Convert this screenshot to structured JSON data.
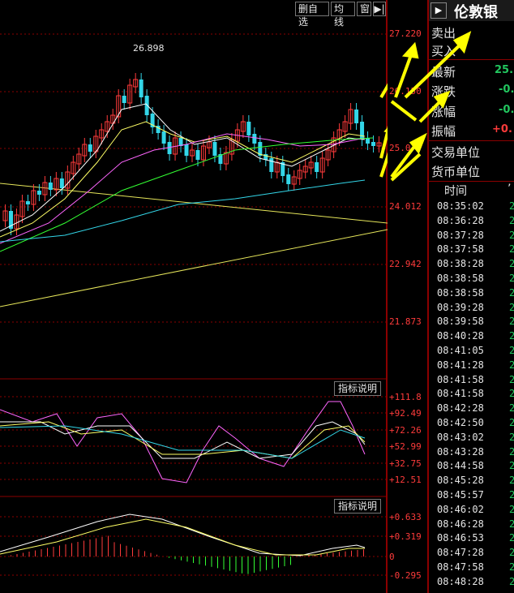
{
  "toolbar": {
    "delete_watch": "删自选",
    "ma_lines": "均线",
    "window": "窗",
    "collapse_icon": "right-arrow-collapse"
  },
  "main_axis": [
    "27.220",
    "26.150",
    "25.0",
    "24.012",
    "22.942",
    "21.873"
  ],
  "high_marker": "26.898",
  "rsi_panel": {
    "button": "指标说明",
    "axis": [
      "+111.8",
      "+92.49",
      "+72.26",
      "+52.99",
      "+32.75",
      "+12.51"
    ]
  },
  "macd_panel": {
    "button": "指标说明",
    "axis": [
      "+0.633",
      "+0.319",
      "0",
      "-0.295"
    ]
  },
  "quote": {
    "title": "伦敦银",
    "sell": "卖出",
    "buy": "买入",
    "latest_label": "最新",
    "latest_value": "25.",
    "change_label": "涨跌",
    "change_value": "-0.",
    "change_pct_label": "涨幅",
    "change_pct_value": "-0.",
    "amplitude_label": "振幅",
    "amplitude_value": "+0.",
    "trade_unit_label": "交易单位",
    "currency_label": "货币单位",
    "time_header": "时间",
    "ticks": [
      {
        "time": "08:35:02",
        "price": "2"
      },
      {
        "time": "08:36:28",
        "price": "2"
      },
      {
        "time": "08:37:28",
        "price": "2"
      },
      {
        "time": "08:37:58",
        "price": "2"
      },
      {
        "time": "08:38:28",
        "price": "2"
      },
      {
        "time": "08:38:58",
        "price": "2"
      },
      {
        "time": "08:38:58",
        "price": "2"
      },
      {
        "time": "08:39:28",
        "price": "2"
      },
      {
        "time": "08:39:58",
        "price": "2"
      },
      {
        "time": "08:40:28",
        "price": "2"
      },
      {
        "time": "08:41:05",
        "price": "2"
      },
      {
        "time": "08:41:28",
        "price": "2"
      },
      {
        "time": "08:41:58",
        "price": "2"
      },
      {
        "time": "08:41:58",
        "price": "2"
      },
      {
        "time": "08:42:28",
        "price": "2"
      },
      {
        "time": "08:42:50",
        "price": "2"
      },
      {
        "time": "08:43:02",
        "price": "2"
      },
      {
        "time": "08:43:28",
        "price": "2"
      },
      {
        "time": "08:44:58",
        "price": "2"
      },
      {
        "time": "08:45:28",
        "price": "2"
      },
      {
        "time": "08:45:57",
        "price": "2"
      },
      {
        "time": "08:46:02",
        "price": "2"
      },
      {
        "time": "08:46:28",
        "price": "2"
      },
      {
        "time": "08:46:53",
        "price": "2"
      },
      {
        "time": "08:47:28",
        "price": "2"
      },
      {
        "time": "08:47:58",
        "price": "2"
      },
      {
        "time": "08:48:28",
        "price": "2"
      }
    ]
  },
  "colors": {
    "up": "#ff3b3b",
    "down": "#33d6e8",
    "axis": "#ff3b3b",
    "grid": "#8b0000",
    "ann": "#ffff00"
  }
}
